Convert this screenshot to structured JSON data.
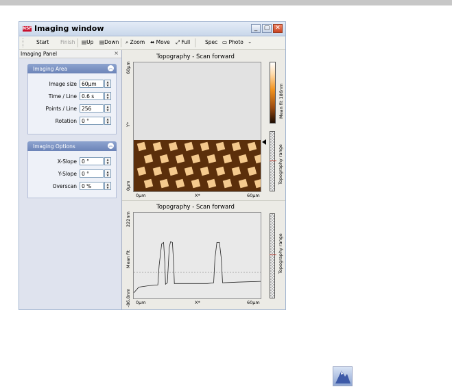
{
  "window": {
    "title": "Imaging window",
    "app_badge": "NSF"
  },
  "toolbar": {
    "start": "Start",
    "finish": "Finish",
    "up": "▤Up",
    "down": "▤Down",
    "zoom": "⌕ Zoom",
    "move": "⬌ Move",
    "full": "⤢ Full",
    "spec": "Spec",
    "photo": "▭ Photo",
    "photo_dropdown": "⌄"
  },
  "panel": {
    "title": "Imaging Panel",
    "close": "×",
    "imaging_area": {
      "title": "Imaging Area",
      "rows": [
        {
          "label": "Image size",
          "value": "60µm"
        },
        {
          "label": "Time / Line",
          "value": "0.6 s"
        },
        {
          "label": "Points / Line",
          "value": "256"
        },
        {
          "label": "Rotation",
          "value": "0 °"
        }
      ]
    },
    "imaging_options": {
      "title": "Imaging Options",
      "rows": [
        {
          "label": "X-Slope",
          "value": "0 °"
        },
        {
          "label": "Y-Slope",
          "value": "0 °"
        },
        {
          "label": "Overscan",
          "value": "0 %"
        }
      ]
    }
  },
  "image_view": {
    "title": "Topography - Scan forward",
    "y_top": "60µm",
    "y_mid": "Y*",
    "y_bottom": "0µm",
    "x_left": "0µm",
    "x_mid": "X*",
    "x_right": "60µm",
    "colorbar_label": "Mean fit 186nm",
    "range_label": "Topography range"
  },
  "line_view": {
    "title": "Topography - Scan forward",
    "y_top": "222nm",
    "y_mid": "Mean fit",
    "y_bottom": "-86.8nm",
    "x_left": "0µm",
    "x_mid": "X*",
    "x_right": "60µm",
    "range_label": "Topography range",
    "profile": [
      [
        0,
        2
      ],
      [
        0.04,
        10
      ],
      [
        0.12,
        12
      ],
      [
        0.19,
        13
      ],
      [
        0.2,
        40
      ],
      [
        0.22,
        70
      ],
      [
        0.235,
        72
      ],
      [
        0.245,
        45
      ],
      [
        0.25,
        14
      ],
      [
        0.265,
        16
      ],
      [
        0.28,
        65
      ],
      [
        0.29,
        73
      ],
      [
        0.305,
        72
      ],
      [
        0.315,
        40
      ],
      [
        0.32,
        15
      ],
      [
        0.45,
        15
      ],
      [
        0.58,
        15
      ],
      [
        0.63,
        16
      ],
      [
        0.64,
        50
      ],
      [
        0.655,
        72
      ],
      [
        0.675,
        72
      ],
      [
        0.69,
        50
      ],
      [
        0.7,
        16
      ],
      [
        0.82,
        17
      ],
      [
        1.0,
        18
      ]
    ]
  },
  "colors": {
    "accent": "#6c84b8",
    "window_border": "#9fb3cf",
    "close_button": "#c8421f"
  }
}
